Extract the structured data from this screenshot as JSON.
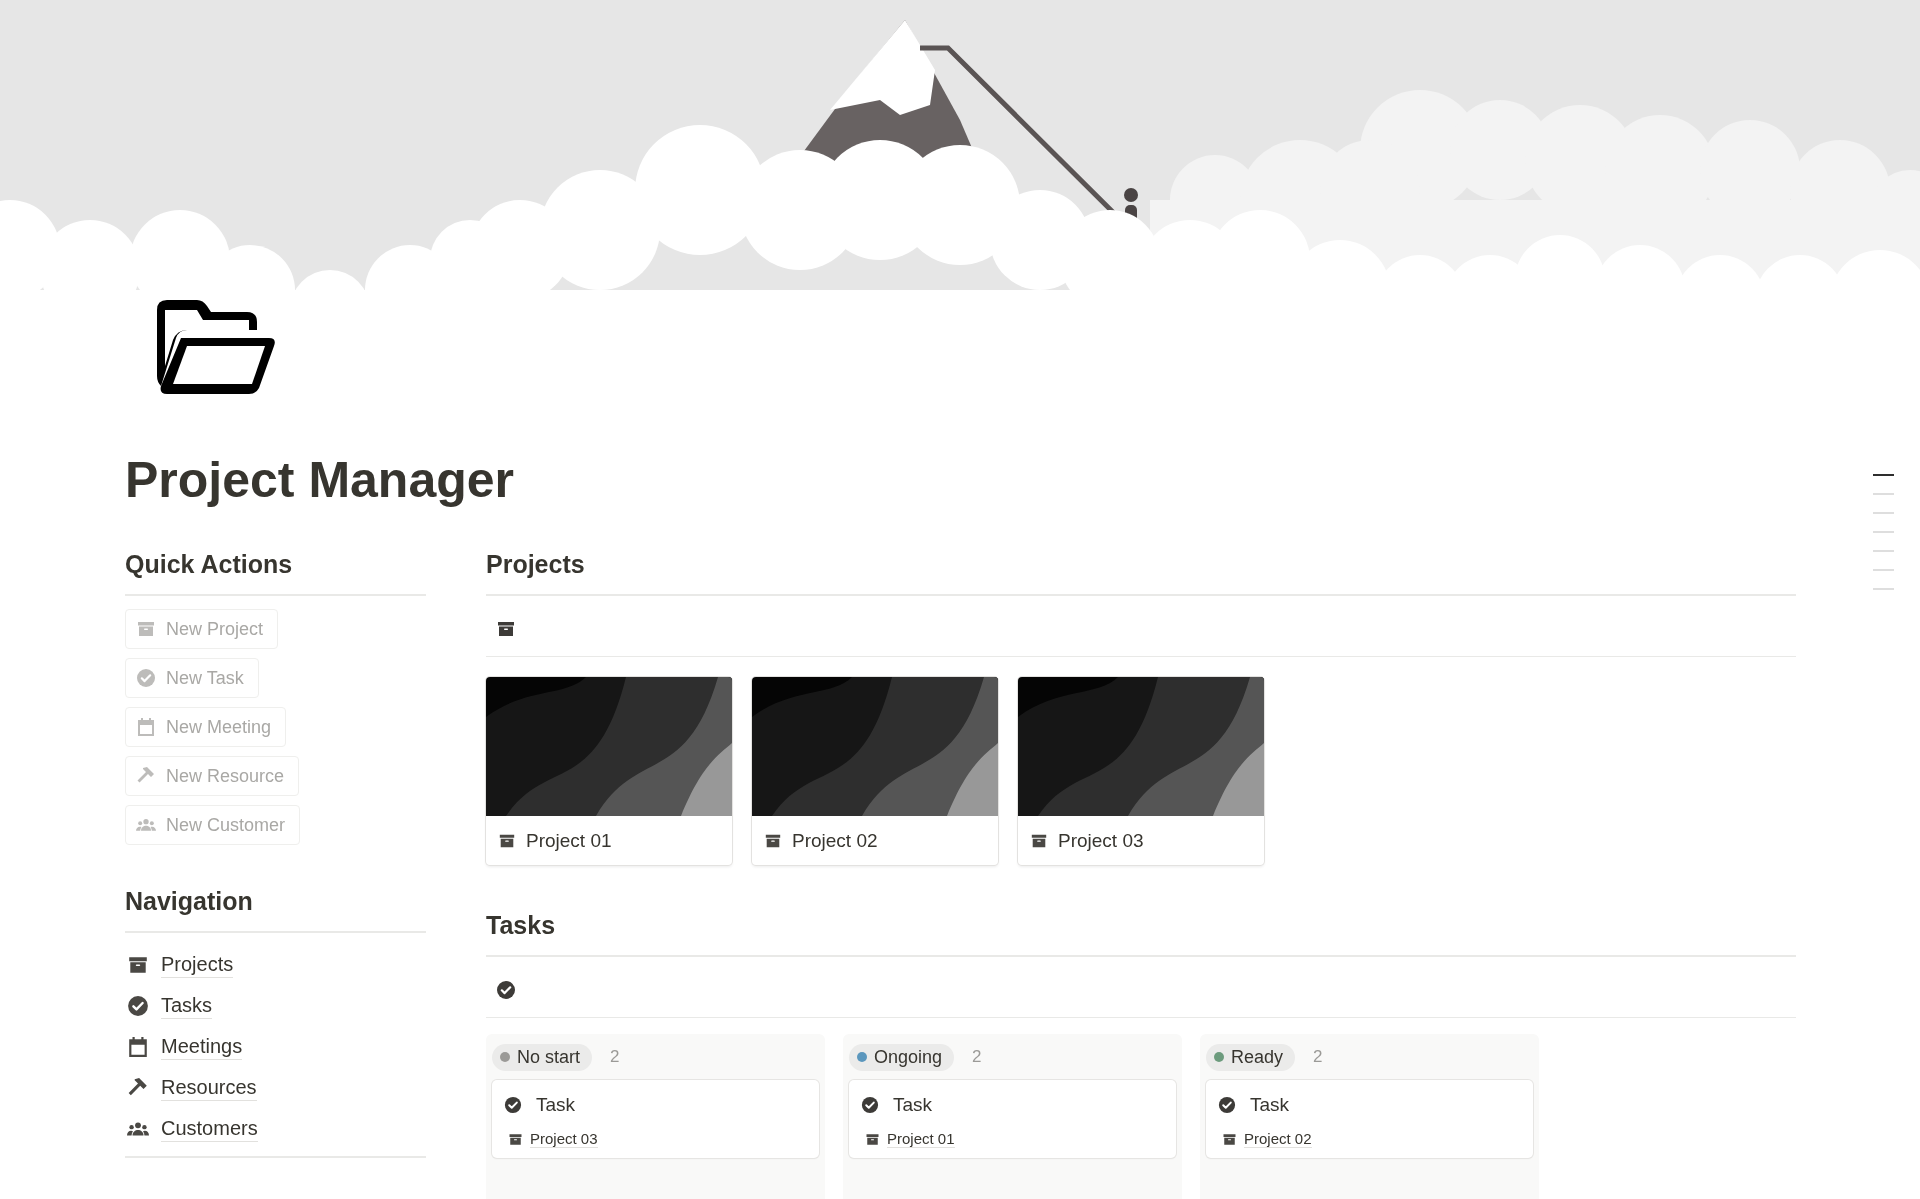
{
  "page": {
    "title": "Project Manager"
  },
  "quick_actions": {
    "heading": "Quick Actions",
    "buttons": [
      {
        "label": "New Project",
        "kind": "project"
      },
      {
        "label": "New Task",
        "kind": "task"
      },
      {
        "label": "New Meeting",
        "kind": "meeting"
      },
      {
        "label": "New Resource",
        "kind": "resource"
      },
      {
        "label": "New Customer",
        "kind": "customer"
      }
    ]
  },
  "navigation": {
    "heading": "Navigation",
    "links": [
      {
        "label": "Projects",
        "kind": "project"
      },
      {
        "label": "Tasks",
        "kind": "task"
      },
      {
        "label": "Meetings",
        "kind": "meeting"
      },
      {
        "label": "Resources",
        "kind": "resource"
      },
      {
        "label": "Customers",
        "kind": "customer"
      }
    ]
  },
  "projects": {
    "heading": "Projects",
    "cards": [
      {
        "title": "Project 01"
      },
      {
        "title": "Project 02"
      },
      {
        "title": "Project 03"
      }
    ]
  },
  "tasks": {
    "heading": "Tasks",
    "columns": [
      {
        "status": "No start",
        "color": "#9b9a97",
        "count": "2",
        "cards": [
          {
            "title": "Task",
            "project": "Project 03"
          }
        ]
      },
      {
        "status": "Ongoing",
        "color": "#5b97bd",
        "count": "2",
        "cards": [
          {
            "title": "Task",
            "project": "Project 01"
          }
        ]
      },
      {
        "status": "Ready",
        "color": "#6c9b7d",
        "count": "2",
        "cards": [
          {
            "title": "Task",
            "project": "Project 02"
          }
        ]
      }
    ]
  },
  "outline": [
    {
      "selected": true
    },
    {
      "selected": false
    },
    {
      "selected": false
    },
    {
      "selected": false
    },
    {
      "selected": false
    },
    {
      "selected": false
    },
    {
      "selected": false
    }
  ]
}
